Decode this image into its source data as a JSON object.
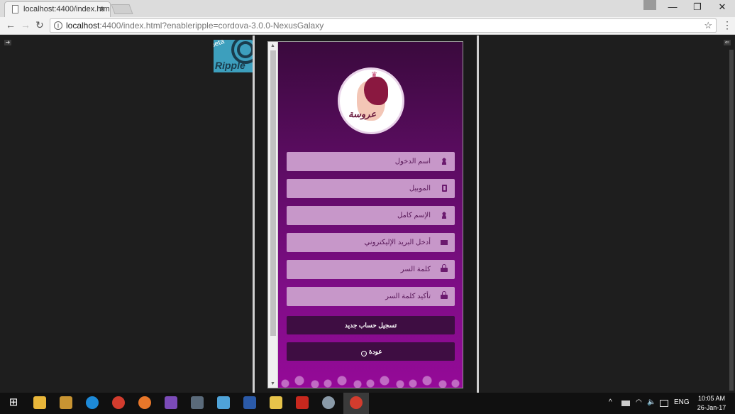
{
  "browser": {
    "tab_title": "localhost:4400/index.htm",
    "tab_close": "×",
    "url_host": "localhost",
    "url_rest": ":4400/index.html?enableripple=cordova-3.0.0-NexusGalaxy",
    "back_icon": "←",
    "forward_icon": "→",
    "reload_icon": "↻",
    "bookmark_icon": "☆",
    "menu_icon": "⋮",
    "minimize_icon": "—",
    "restore_icon": "❐",
    "close_icon": "✕"
  },
  "ripple": {
    "word": "Ripple",
    "beta": "beta"
  },
  "app": {
    "logo_text": "عروسة",
    "fields": {
      "username": "اسم الدخول",
      "mobile": "الموبيل",
      "fullname": "الإسم كامل",
      "email": "أدخل البريد الإليكتروني",
      "password": "كلمة السر",
      "confirm_password": "تأكيد كلمة السر"
    },
    "register_button": "تسجيل حساب جديد",
    "back_button": "عودة"
  },
  "taskbar": {
    "language": "ENG",
    "time": "10:05 AM",
    "date": "26-Jan-17",
    "tray_up": "^"
  },
  "colors": {
    "accent_purple": "#7d0d85",
    "field_bg": "#c797c9",
    "button_bg": "#3e0d42"
  }
}
